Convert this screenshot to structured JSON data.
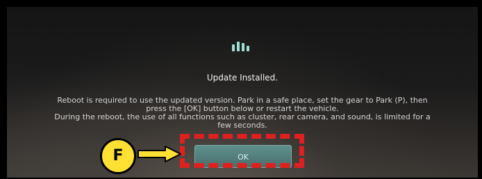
{
  "dialog": {
    "title": "Update Installed.",
    "message_lines": [
      "Reboot is required to use the updated version. Park in a safe place, set the gear to Park (P), then",
      "press the [OK] button below or restart the vehicle.",
      "During the reboot, the use of all functions such as cluster, rear camera, and sound, is limited for a",
      "few seconds."
    ],
    "ok_label": "OK"
  },
  "callout": {
    "label": "F"
  },
  "colors": {
    "accent": "#5f908c",
    "highlight_red": "#e02020",
    "callout_yellow": "#ffe033",
    "icon_teal": "#9fe0d3"
  },
  "icons": {
    "update": "update-progress-icon"
  }
}
